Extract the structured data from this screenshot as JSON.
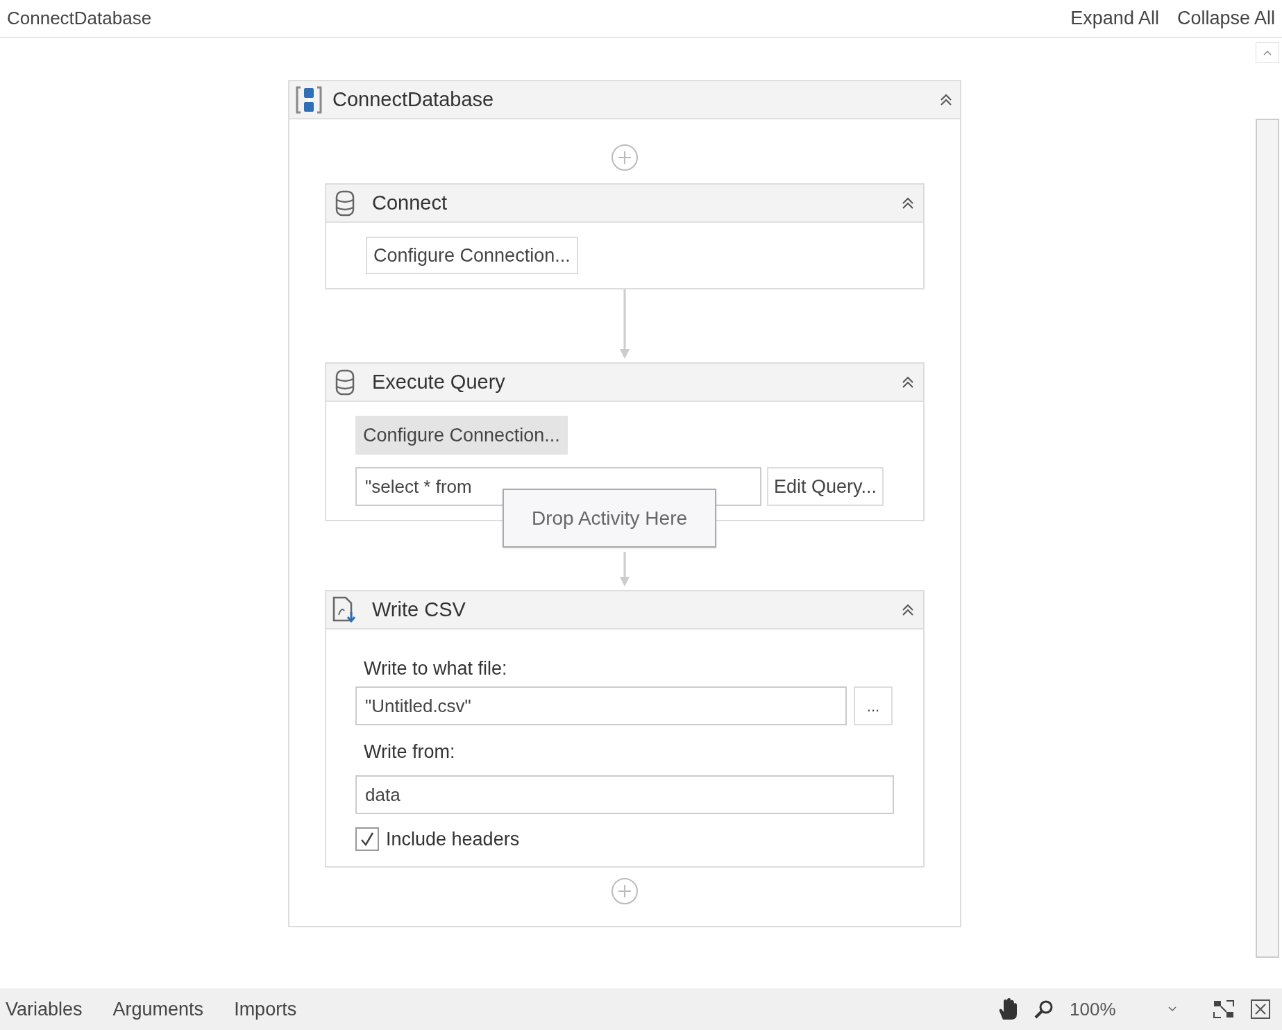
{
  "header": {
    "title": "ConnectDatabase",
    "actions": [
      "Expand All",
      "Collapse All"
    ]
  },
  "sequence": {
    "title": "ConnectDatabase",
    "expanded": true,
    "activities": [
      {
        "kind": "connect",
        "title": "Connect",
        "expanded": true,
        "configure_button": {
          "label": "Configure Connection...",
          "selected": false
        }
      },
      {
        "kind": "query",
        "title": "Execute Query",
        "expanded": true,
        "configure_button": {
          "label": "Configure Connection...",
          "selected": true
        },
        "query_value": "\"select * from",
        "edit_button": "Edit Query..."
      },
      {
        "kind": "csv",
        "title": "Write CSV",
        "expanded": true,
        "file_label": "Write to what file:",
        "file_value": "\"Untitled.csv\"",
        "browse_button": "...",
        "from_label": "Write from:",
        "from_value": "data",
        "include_headers": {
          "label": "Include headers",
          "checked": true
        }
      }
    ]
  },
  "drop_hint": "Drop Activity Here",
  "bottom_bar": {
    "tabs": [
      "Variables",
      "Arguments",
      "Imports"
    ],
    "zoom": "100%"
  }
}
